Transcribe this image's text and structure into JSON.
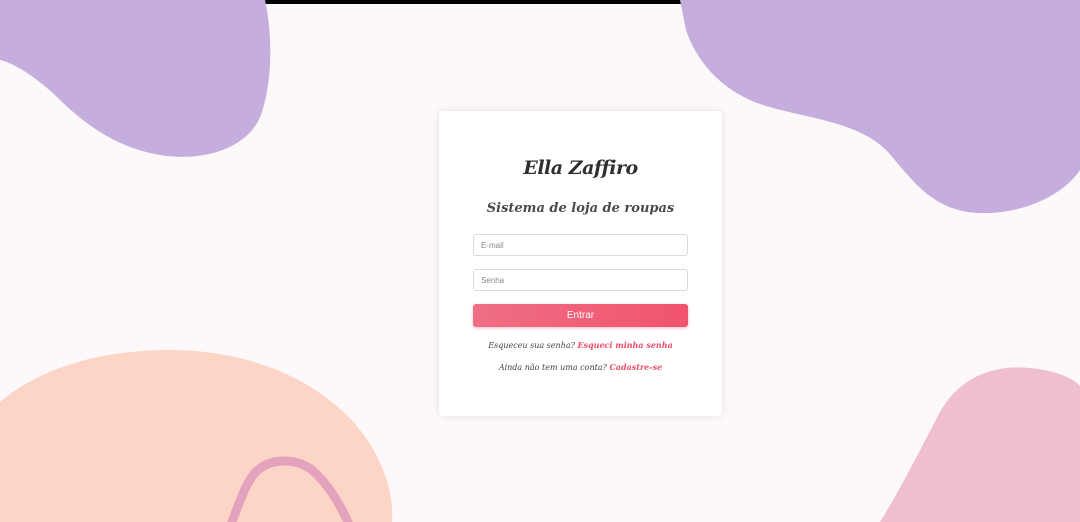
{
  "brand": {
    "name": "Ella Zaffiro",
    "tagline": "Sistema de loja de roupas"
  },
  "login_form": {
    "email_placeholder": "E-mail",
    "password_placeholder": "Senha",
    "submit_label": "Entrar"
  },
  "links": {
    "forgot_prompt": "Esqueceu sua senha?",
    "forgot_link": "Esqueci minha senha",
    "signup_prompt": "Ainda não tem uma conta?",
    "signup_link": "Cadastre-se"
  },
  "colors": {
    "background": "#fdf8f9",
    "blob_purple": "#c5aedd",
    "blob_peach": "#fdd5c7",
    "blob_pink": "#efbfcf",
    "stroke_pink": "#e4a3bd",
    "accent": "#ee4d6a",
    "button_gradient_start": "#ef6f84",
    "button_gradient_end": "#f0536d"
  }
}
